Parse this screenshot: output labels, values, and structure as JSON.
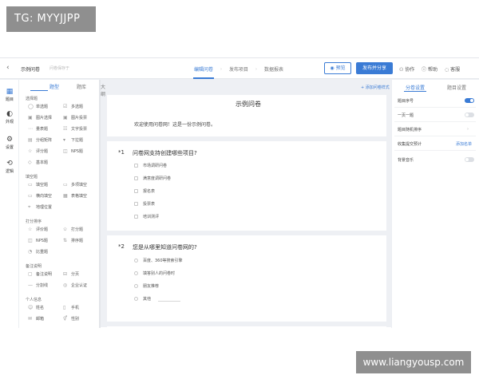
{
  "watermark_top": "TG: MYYJJPP",
  "watermark_bottom": "www.liangyousp.com",
  "topbar": {
    "back_icon": "‹",
    "title": "示例问卷",
    "subtitle": "问卷保存于",
    "tabs": [
      {
        "label": "编辑问卷",
        "active": true
      },
      {
        "label": "发布项目",
        "active": false
      },
      {
        "label": "数据报表",
        "active": false
      }
    ],
    "preview_label": "预览",
    "publish_label": "发布并分享",
    "utils": [
      {
        "icon": "user-icon",
        "label": "协作"
      },
      {
        "icon": "help-icon",
        "label": "帮助"
      },
      {
        "icon": "message-icon",
        "label": "客服"
      }
    ]
  },
  "rail": [
    {
      "icon": "grid-icon",
      "label": "题目"
    },
    {
      "icon": "palette-icon",
      "label": "外观"
    },
    {
      "icon": "gear-icon",
      "label": "设置"
    },
    {
      "icon": "logic-icon",
      "label": "逻辑"
    }
  ],
  "palette": {
    "tabs": [
      "题型",
      "题库",
      "大纲"
    ],
    "groups": [
      {
        "title": "选择题",
        "items": [
          "单选题",
          "多选题",
          "图片选择",
          "图片投票",
          "量表题",
          "文字投票",
          "分组矩阵",
          "下拉题",
          "评分题",
          "NPS题",
          "基本题"
        ]
      },
      {
        "title": "填空题",
        "items": [
          "填空题",
          "多项填空",
          "横向填空",
          "表格填空",
          "地理位置"
        ]
      },
      {
        "title": "打分排序",
        "items": [
          "评价题",
          "打分题",
          "NPS题",
          "排序题",
          "比重题"
        ]
      },
      {
        "title": "备注说明",
        "items": [
          "备注说明",
          "分页",
          "分割线",
          "企业认证"
        ]
      },
      {
        "title": "个人信息",
        "items": [
          "姓名",
          "手机",
          "邮箱",
          "性别"
        ]
      }
    ]
  },
  "canvas": {
    "link": "+ 添加问卷样式",
    "title": "示例问卷",
    "description": "欢迎使用问卷网！这是一份示例问卷。",
    "questions": [
      {
        "num": "*1",
        "text": "问卷网支持创建哪些项目?",
        "options": [
          "市场调研问卷",
          "满意度调研问卷",
          "报名表",
          "投票表",
          "培训测评"
        ]
      },
      {
        "num": "*2",
        "text": "您是从哪里知道问卷网的?",
        "options": [
          "百度、360等搜索引擎",
          "填答别人的问卷时",
          "朋友推荐",
          "其他"
        ]
      }
    ]
  },
  "rpanel": {
    "tabs": [
      "分卷设置",
      "题目设置"
    ],
    "rows": [
      {
        "label": "题目序号",
        "control": "toggle-on"
      },
      {
        "label": "一页一题",
        "control": "toggle-off"
      },
      {
        "label": "题目随机排序",
        "control": "arrow"
      },
      {
        "label": "收集提交预计",
        "control": "link",
        "link": "添加名单"
      },
      {
        "label": "背景音乐",
        "control": "toggle-off"
      }
    ]
  },
  "colors": {
    "accent": "#3a7bd5",
    "canvas_bg": "#eef0f4"
  }
}
